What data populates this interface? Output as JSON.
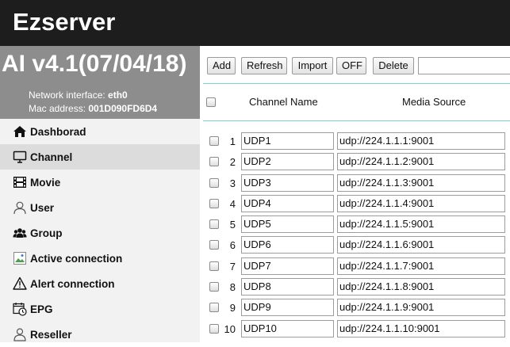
{
  "header": {
    "title": "Ezserver"
  },
  "sidebar": {
    "version": "AI v4.1(07/04/18)",
    "network_label": "Network interface:",
    "network_value": "eth0",
    "mac_label": "Mac address:",
    "mac_value": "001D090FD6D4",
    "items": [
      {
        "label": "Dashborad",
        "icon": "home-icon"
      },
      {
        "label": "Channel",
        "icon": "monitor-icon"
      },
      {
        "label": "Movie",
        "icon": "film-icon"
      },
      {
        "label": "User",
        "icon": "user-icon"
      },
      {
        "label": "Group",
        "icon": "group-icon"
      },
      {
        "label": "Active connection",
        "icon": "image-icon"
      },
      {
        "label": "Alert connection",
        "icon": "alert-icon"
      },
      {
        "label": "EPG",
        "icon": "calendar-clock-icon"
      },
      {
        "label": "Reseller",
        "icon": "reseller-icon"
      }
    ]
  },
  "toolbar": {
    "add": "Add",
    "refresh": "Refresh",
    "import": "Import",
    "off": "OFF",
    "delete": "Delete",
    "filter_value": ""
  },
  "table": {
    "columns": [
      "Channel Name",
      "Media Source"
    ],
    "rows": [
      {
        "num": "1",
        "name": "UDP1",
        "source": "udp://224.1.1.1:9001"
      },
      {
        "num": "2",
        "name": "UDP2",
        "source": "udp://224.1.1.2:9001"
      },
      {
        "num": "3",
        "name": "UDP3",
        "source": "udp://224.1.1.3:9001"
      },
      {
        "num": "4",
        "name": "UDP4",
        "source": "udp://224.1.1.4:9001"
      },
      {
        "num": "5",
        "name": "UDP5",
        "source": "udp://224.1.1.5:9001"
      },
      {
        "num": "6",
        "name": "UDP6",
        "source": "udp://224.1.1.6:9001"
      },
      {
        "num": "7",
        "name": "UDP7",
        "source": "udp://224.1.1.7:9001"
      },
      {
        "num": "8",
        "name": "UDP8",
        "source": "udp://224.1.1.8:9001"
      },
      {
        "num": "9",
        "name": "UDP9",
        "source": "udp://224.1.1.9:9001"
      },
      {
        "num": "10",
        "name": "UDP10",
        "source": "udp://224.1.1.10:9001"
      }
    ]
  }
}
